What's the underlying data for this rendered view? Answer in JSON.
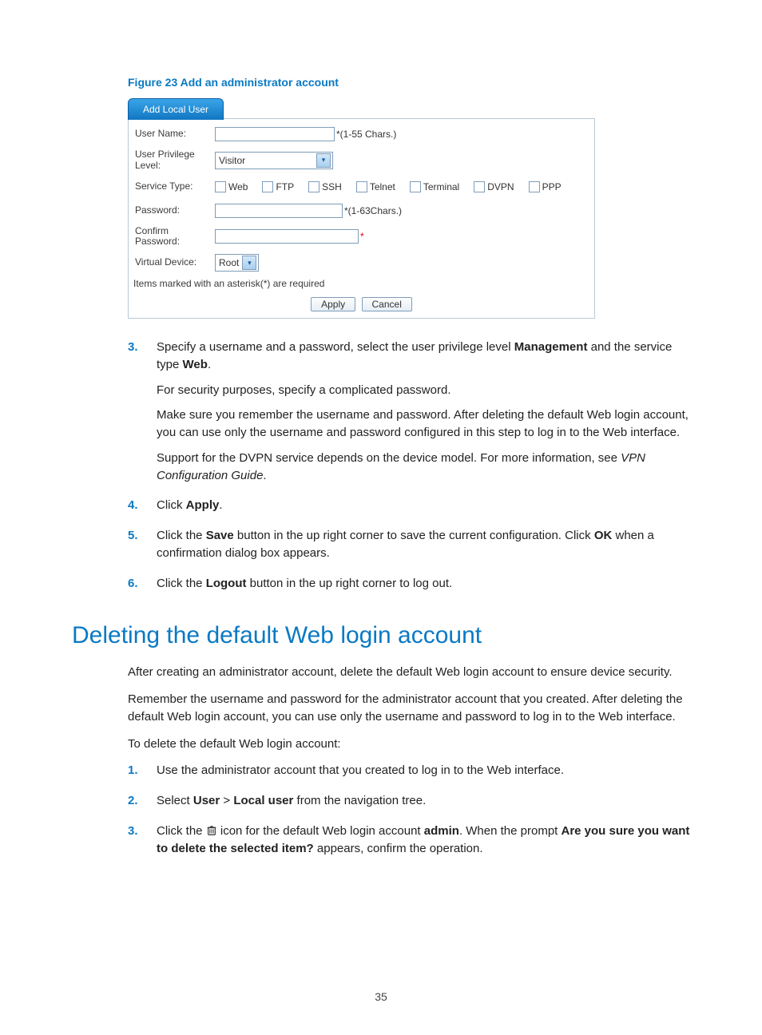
{
  "figure_caption": "Figure 23 Add an administrator account",
  "form": {
    "tab": "Add Local User",
    "rows": {
      "username": {
        "label": "User Name:",
        "hint": "*(1-55 Chars.)"
      },
      "privilege": {
        "label": "User Privilege Level:",
        "value": "Visitor"
      },
      "service": {
        "label": "Service Type:",
        "options": [
          "Web",
          "FTP",
          "SSH",
          "Telnet",
          "Terminal",
          "DVPN",
          "PPP"
        ]
      },
      "password": {
        "label": "Password:",
        "hint": "*(1-63Chars.)"
      },
      "confirm": {
        "label": "Confirm Password:",
        "hint": "*"
      },
      "vdev": {
        "label": "Virtual Device:",
        "value": "Root"
      }
    },
    "required_note": "Items marked with an asterisk(*) are required",
    "buttons": {
      "apply": "Apply",
      "cancel": "Cancel"
    }
  },
  "steps_a": {
    "s3": {
      "p1_a": "Specify a username and a password, select the user privilege level ",
      "p1_b": "Management",
      "p1_c": " and the service type ",
      "p1_d": "Web",
      "p1_e": ".",
      "p2": "For security purposes, specify a complicated password.",
      "p3": "Make sure you remember the username and password. After deleting the default Web login account, you can use only the username and password configured in this step to log in to the Web interface.",
      "p4_a": "Support for the DVPN service depends on the device model. For more information, see ",
      "p4_b": "VPN Configuration Guide",
      "p4_c": "."
    },
    "s4": {
      "a": "Click ",
      "b": "Apply",
      "c": "."
    },
    "s5": {
      "a": "Click the ",
      "b": "Save",
      "c": " button in the up right corner to save the current configuration. Click ",
      "d": "OK",
      "e": " when a confirmation dialog box appears."
    },
    "s6": {
      "a": "Click the ",
      "b": "Logout",
      "c": " button in the up right corner to log out."
    }
  },
  "heading2": "Deleting the default Web login account",
  "para1": "After creating an administrator account, delete the default Web login account to ensure device security.",
  "para2": "Remember the username and password for the administrator account that you created. After deleting the default Web login account, you can use only the username and password to log in to the Web interface.",
  "para3": "To delete the default Web login account:",
  "steps_b": {
    "s1": "Use the administrator account that you created to log in to the Web interface.",
    "s2": {
      "a": "Select ",
      "b": "User",
      "c": " > ",
      "d": "Local user",
      "e": " from the navigation tree."
    },
    "s3": {
      "a": "Click the ",
      "b": " icon for the default Web login account ",
      "c": "admin",
      "d": ". When the prompt ",
      "e": "Are you sure you want to delete the selected item?",
      "f": " appears, confirm the operation."
    }
  },
  "page_number": "35"
}
